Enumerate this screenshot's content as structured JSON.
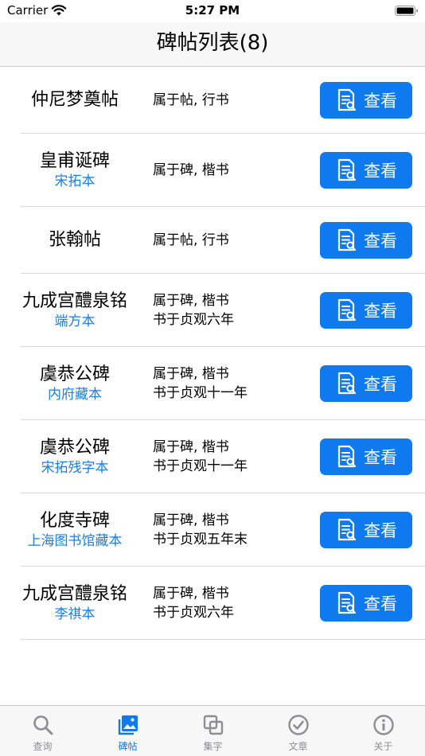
{
  "status_bar": {
    "carrier": "Carrier",
    "time": "5:27 PM"
  },
  "nav": {
    "title": "碑帖列表(8)"
  },
  "rows": [
    {
      "title": "仲尼梦奠帖",
      "version": "",
      "line1": "属于帖, 行书",
      "line2": "",
      "button": "查看"
    },
    {
      "title": "皇甫诞碑",
      "version": "宋拓本",
      "line1": "属于碑, 楷书",
      "line2": "",
      "button": "查看"
    },
    {
      "title": "张翰帖",
      "version": "",
      "line1": "属于帖, 行书",
      "line2": "",
      "button": "查看"
    },
    {
      "title": "九成宫醴泉铭",
      "version": "端方本",
      "line1": "属于碑, 楷书",
      "line2": "书于贞观六年",
      "button": "查看"
    },
    {
      "title": "虞恭公碑",
      "version": "内府藏本",
      "line1": "属于碑, 楷书",
      "line2": "书于贞观十一年",
      "button": "查看"
    },
    {
      "title": "虞恭公碑",
      "version": "宋拓残字本",
      "line1": "属于碑, 楷书",
      "line2": "书于贞观十一年",
      "button": "查看"
    },
    {
      "title": "化度寺碑",
      "version": "上海图书馆藏本",
      "line1": "属于碑, 楷书",
      "line2": "书于贞观五年末",
      "button": "查看"
    },
    {
      "title": "九成宫醴泉铭",
      "version": "李祺本",
      "line1": "属于碑, 楷书",
      "line2": "书于贞观六年",
      "button": "查看"
    }
  ],
  "tabs": [
    {
      "label": "查询",
      "icon": "search-icon",
      "active": false
    },
    {
      "label": "碑帖",
      "icon": "photo-icon",
      "active": true
    },
    {
      "label": "集字",
      "icon": "collage-icon",
      "active": false
    },
    {
      "label": "文章",
      "icon": "checkmark-circle-icon",
      "active": false
    },
    {
      "label": "关于",
      "icon": "info-circle-icon",
      "active": false
    }
  ],
  "colors": {
    "accent": "#0f7aef",
    "version_text": "#1a7ee6",
    "tab_inactive": "#8e8e93",
    "bar_bg": "#f7f7f7"
  }
}
